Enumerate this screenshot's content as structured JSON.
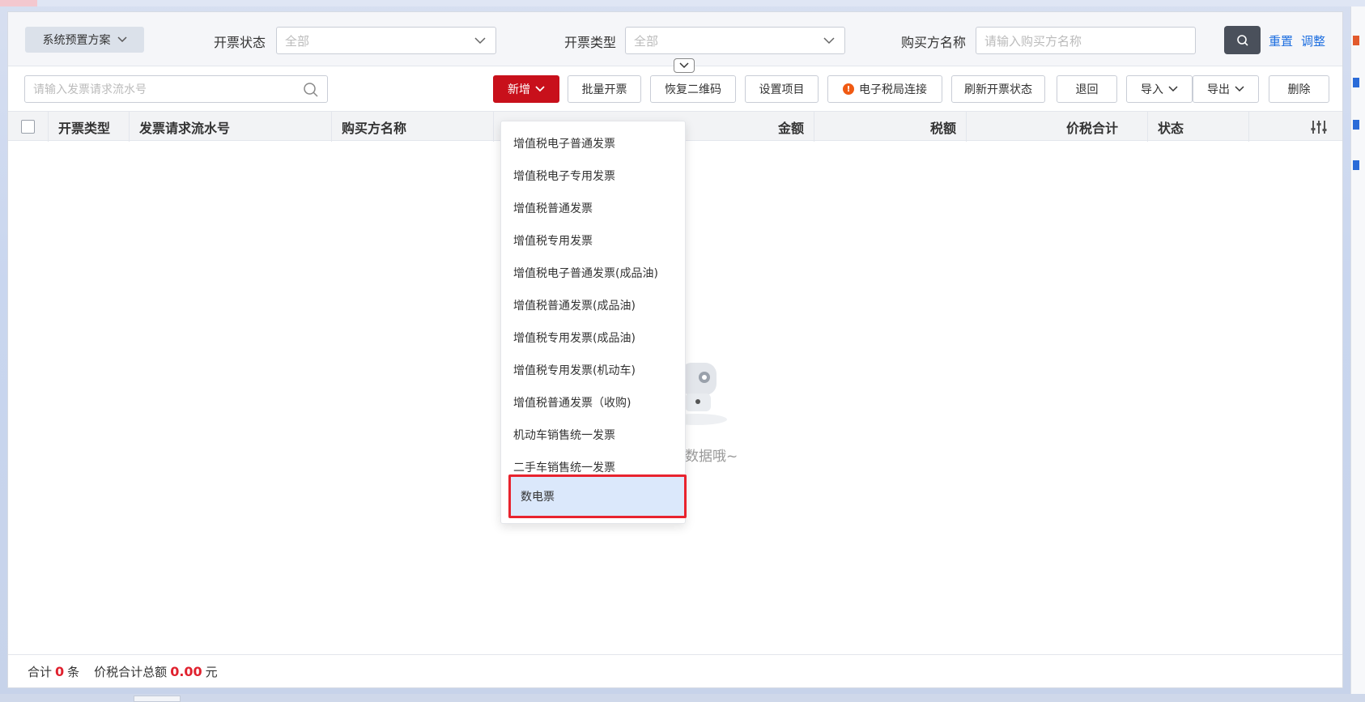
{
  "filter": {
    "scheme_label": "系统预置方案",
    "status_label": "开票状态",
    "status_value": "全部",
    "type_label": "开票类型",
    "type_value": "全部",
    "buyer_label": "购买方名称",
    "buyer_placeholder": "请输入购买方名称",
    "reset_label": "重置",
    "adjust_label": "调整"
  },
  "toolbar": {
    "serial_placeholder": "请输入发票请求流水号",
    "add_label": "新增",
    "batch_label": "批量开票",
    "restore_qr_label": "恢复二维码",
    "settings_label": "设置项目",
    "tax_connect_label": "电子税局连接",
    "refresh_label": "刷新开票状态",
    "return_label": "退回",
    "import_label": "导入",
    "export_label": "导出",
    "delete_label": "删除"
  },
  "table": {
    "columns": [
      "开票类型",
      "发票请求流水号",
      "购买方名称",
      "金额",
      "税额",
      "价税合计",
      "状态"
    ]
  },
  "empty": {
    "text": "数据哦~"
  },
  "footer": {
    "total_prefix": "合计",
    "count": "0",
    "count_unit": "条",
    "sum_label": "价税合计总额",
    "sum_value": "0.00",
    "sum_unit": "元"
  },
  "dropdown": {
    "items": [
      "增值税电子普通发票",
      "增值税电子专用发票",
      "增值税普通发票",
      "增值税专用发票",
      "增值税电子普通发票(成品油)",
      "增值税普通发票(成品油)",
      "增值税专用发票(成品油)",
      "增值税专用发票(机动车)",
      "增值税普通发票（收购)",
      "机动车销售统一发票",
      "二手车销售统一发票",
      "数电票"
    ],
    "selected": "数电票"
  },
  "colors": {
    "primary_red": "#c8101b",
    "link_blue": "#1e6fe0",
    "highlight_border": "#e8232e",
    "highlight_bg": "#dbe8fb"
  }
}
